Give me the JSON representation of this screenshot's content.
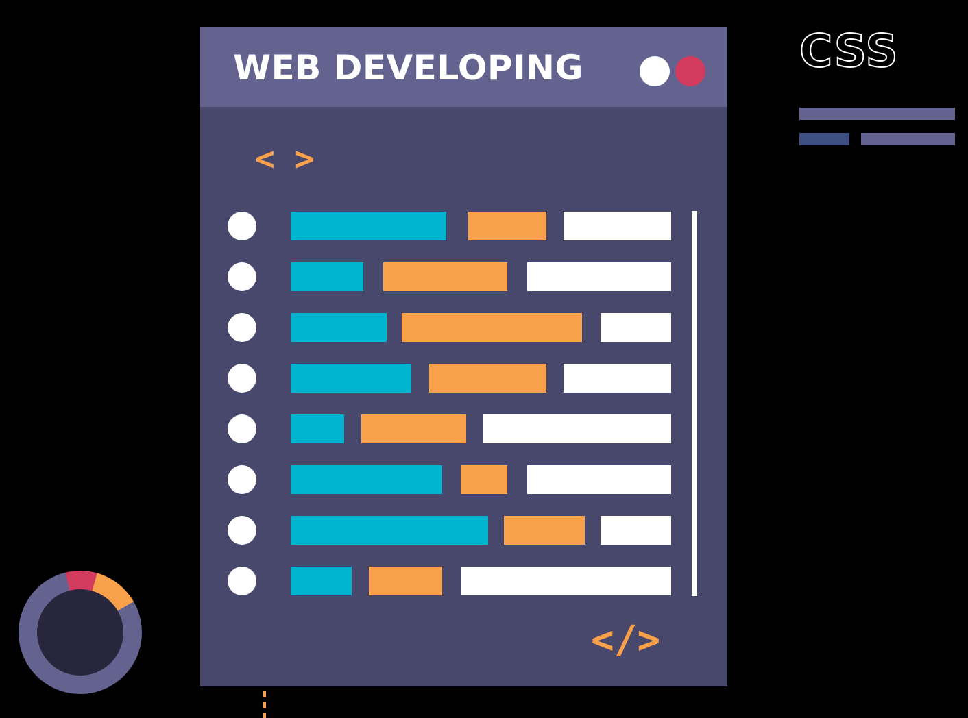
{
  "window": {
    "title": "WEB DEVELOPING",
    "open_tag": "< >",
    "close_tag": "</>"
  },
  "side_panel": {
    "label": "CSS"
  },
  "colors": {
    "background": "#000000",
    "window_body": "#48476c",
    "titlebar": "#64628f",
    "cyan": "#00b3cf",
    "orange": "#f9a04b",
    "white": "#ffffff",
    "red": "#d23a5e",
    "donut_ring": "#64628f",
    "donut_hole": "#27263d",
    "css_bar_dark": "#3e4f82"
  },
  "icons": {
    "window_dots": [
      "white-circle-icon",
      "red-circle-icon"
    ],
    "row_bullet": "white-circle-icon"
  }
}
